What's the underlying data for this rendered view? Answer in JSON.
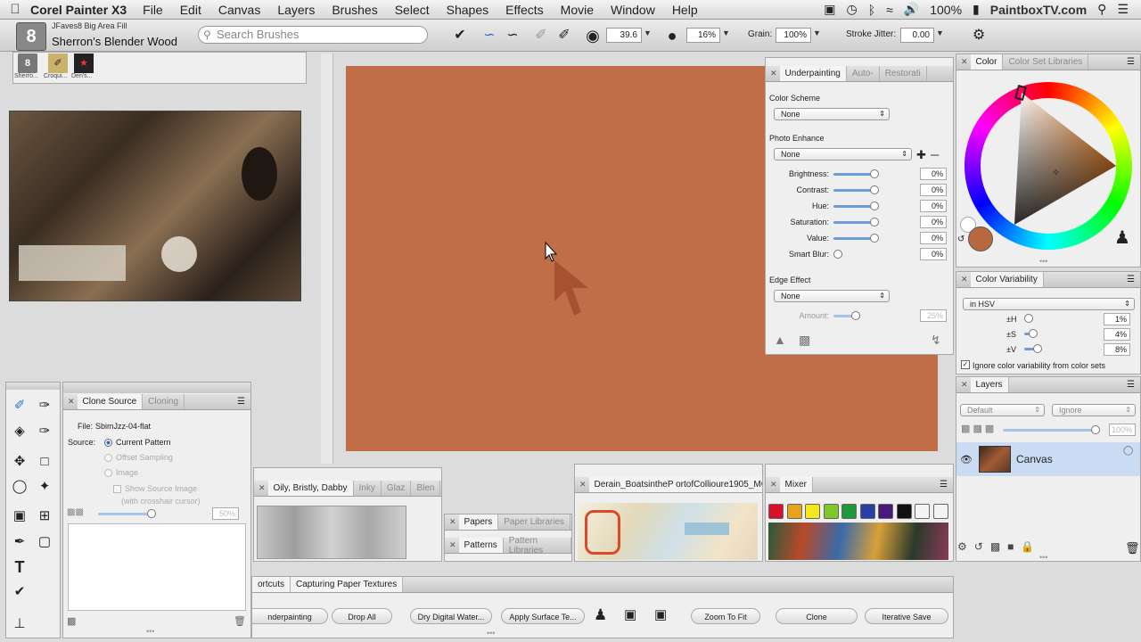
{
  "menubar": {
    "app_name": "Corel Painter X3",
    "menus": [
      "File",
      "Edit",
      "Canvas",
      "Layers",
      "Brushes",
      "Select",
      "Shapes",
      "Effects",
      "Movie",
      "Window",
      "Help"
    ],
    "battery": "100%",
    "site": "PaintboxTV.com"
  },
  "toolbar": {
    "brush_category": "JFaves8 Big Area Fill",
    "brush_name": "Sherron's Blender Wood",
    "search_placeholder": "Search Brushes",
    "size_value": "39.6",
    "opacity_value": "16%",
    "grain_label": "Grain:",
    "grain_value": "100%",
    "jitter_label": "Stroke Jitter:",
    "jitter_value": "0.00"
  },
  "recent_brushes": [
    "Sherro...",
    "Croqui...",
    "Den's..."
  ],
  "underpainting": {
    "tabs": [
      "Underpainting",
      "Auto-",
      "Restorati"
    ],
    "color_scheme_label": "Color Scheme",
    "color_scheme_value": "None",
    "photo_enhance_label": "Photo Enhance",
    "photo_enhance_value": "None",
    "sliders": [
      {
        "label": "Brightness:",
        "value": "0%"
      },
      {
        "label": "Contrast:",
        "value": "0%"
      },
      {
        "label": "Hue:",
        "value": "0%"
      },
      {
        "label": "Saturation:",
        "value": "0%"
      },
      {
        "label": "Value:",
        "value": "0%"
      },
      {
        "label": "Smart Blur:",
        "value": "0%"
      }
    ],
    "edge_effect_label": "Edge Effect",
    "edge_effect_value": "None",
    "amount_label": "Amount:",
    "amount_value": "25%"
  },
  "color_panel": {
    "tabs": [
      "Color",
      "Color Set Libraries"
    ],
    "current_color": "#b8683e"
  },
  "color_variability": {
    "title": "Color Variability",
    "mode": "in HSV",
    "rows": [
      {
        "label": "±H",
        "value": "1%"
      },
      {
        "label": "±S",
        "value": "4%"
      },
      {
        "label": "±V",
        "value": "8%"
      }
    ],
    "checkbox_label": "Ignore color variability from color sets"
  },
  "layers": {
    "title": "Layers",
    "composite": "Default",
    "method": "Ignore",
    "opacity": "100%",
    "layer_name": "Canvas"
  },
  "clone_source": {
    "tabs": [
      "Clone Source",
      "Cloning"
    ],
    "file_label": "File:",
    "file_name": "SbimJzz-04-flat",
    "source_label": "Source:",
    "options": [
      "Current Pattern",
      "Offset Sampling",
      "Image"
    ],
    "show_source": "Show Source Image",
    "crosshair": "(with crosshair cursor)",
    "opacity": "50%"
  },
  "brush_library": {
    "tabs": [
      "Oily, Bristly, Dabby",
      "Inky",
      "Glaz",
      "Blen"
    ]
  },
  "papers": {
    "tabs": [
      "Papers",
      "Paper Libraries"
    ]
  },
  "patterns": {
    "tabs": [
      "Patterns",
      "Pattern Libraries"
    ]
  },
  "reference": {
    "title": "Derain_BoatsintheP ortofCollioure1905_MG_9"
  },
  "mixer": {
    "title": "Mixer",
    "colors": [
      "#d8102a",
      "#e9a21c",
      "#f2e81c",
      "#7ec82a",
      "#1e9a3c",
      "#2a3ea8",
      "#4a1a78",
      "#111111",
      "#f4f4f4",
      "#f4f4f4"
    ]
  },
  "shortcuts": {
    "tabs": [
      "ortcuts",
      "Capturing Paper Textures"
    ],
    "buttons": [
      "nderpainting",
      "Drop All",
      "Dry Digital Water...",
      "Apply Surface Te...",
      "Zoom To Fit",
      "Clone",
      "Iterative Save"
    ]
  }
}
